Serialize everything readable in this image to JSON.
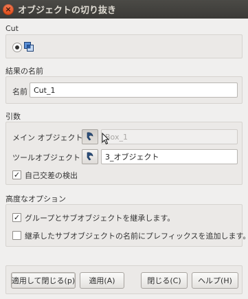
{
  "window": {
    "title": "オブジェクトの切り抜き",
    "close_glyph": "×"
  },
  "cut": {
    "section_label": "Cut"
  },
  "result_name": {
    "section_label": "結果の名前",
    "name_label": "名前",
    "name_value": "Cut_1"
  },
  "arguments": {
    "section_label": "引数",
    "main_object_label": "メイン オブジェクト",
    "main_object_value": "Box_1",
    "tool_object_label": "ツールオブジェクト",
    "tool_object_value": "3_オブジェクト",
    "self_intersection_label": "自己交差の検出",
    "self_intersection_checked": true
  },
  "advanced": {
    "section_label": "高度なオプション",
    "inherit_groups_label": "グループとサブオブジェクトを継承します。",
    "inherit_groups_checked": true,
    "add_prefix_label": "継承したサブオブジェクトの名前にプレフィックスを追加します。",
    "add_prefix_checked": false
  },
  "buttons": {
    "apply_close": "適用して閉じる(p)",
    "apply": "適用(A)",
    "close": "閉じる(C)",
    "help": "ヘルプ(H)"
  },
  "colors": {
    "titlebar": "#3f3e3a",
    "close_button": "#e95420",
    "window_bg": "#f0efee"
  },
  "icons": {
    "cut_mode": "boolean-cut-icon",
    "selector": "pointer-select-icon"
  }
}
